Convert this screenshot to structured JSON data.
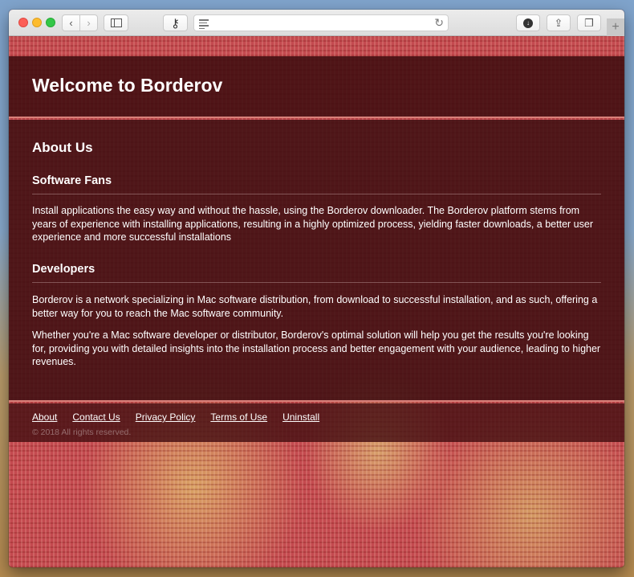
{
  "browser": {
    "url": "",
    "icons": {
      "back": "chevron-left-icon",
      "forward": "chevron-right-icon",
      "sidebar": "sidebar-icon",
      "key": "key-icon",
      "reader": "reader-icon",
      "reload": "reload-icon",
      "downloads": "download-icon",
      "share": "share-icon",
      "tabs": "tabs-icon",
      "new_tab": "plus-icon"
    },
    "glyphs": {
      "back": "‹",
      "forward": "›",
      "key": "⚷",
      "reload": "↻",
      "download": "↓",
      "share": "⇪",
      "tabs": "❐",
      "new_tab": "+"
    }
  },
  "page": {
    "title": "Welcome to Borderov",
    "about_heading": "About Us",
    "sections": [
      {
        "heading": "Software Fans",
        "paragraphs": [
          "Install applications the easy way and without the hassle, using the Borderov downloader. The Borderov platform stems from years of experience with installing applications, resulting in a highly optimized process, yielding faster downloads, a better user experience and more successful installations"
        ]
      },
      {
        "heading": "Developers",
        "paragraphs": [
          "Borderov is a network specializing in Mac software distribution, from download to successful installation, and as such, offering a better way for you to reach the Mac software community.",
          "Whether you're a Mac software developer or distributor, Borderov's optimal solution will help you get the results you're looking for, providing you with detailed insights into the installation process and better engagement with your audience, leading to higher revenues."
        ]
      }
    ],
    "footer": {
      "links": [
        "About",
        "Contact Us",
        "Privacy Policy",
        "Terms of Use",
        "Uninstall"
      ],
      "copyright": "© 2018 All rights reserved."
    }
  }
}
